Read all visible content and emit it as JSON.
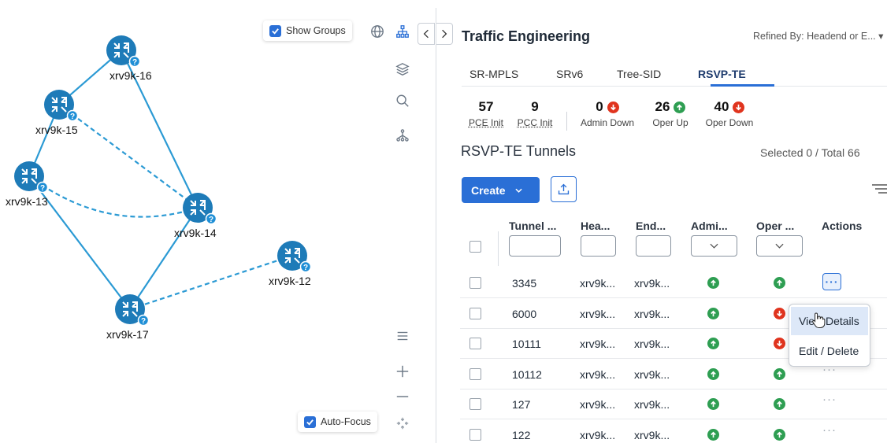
{
  "topology": {
    "show_groups_label": "Show Groups",
    "auto_focus_label": "Auto-Focus",
    "nodes": [
      {
        "id": "xrv9k-16",
        "label": "xrv9k-16"
      },
      {
        "id": "xrv9k-15",
        "label": "xrv9k-15"
      },
      {
        "id": "xrv9k-13",
        "label": "xrv9k-13"
      },
      {
        "id": "xrv9k-14",
        "label": "xrv9k-14"
      },
      {
        "id": "xrv9k-12",
        "label": "xrv9k-12"
      },
      {
        "id": "xrv9k-17",
        "label": "xrv9k-17"
      }
    ],
    "node_color": "#1e7bb8",
    "link_color": "#2b9ad4",
    "badge_text": "?",
    "tools": [
      "globe-icon",
      "hierarchy-icon",
      "layers-icon",
      "search-icon",
      "tree-icon",
      "list-icon",
      "zoom-in-icon",
      "zoom-out-icon",
      "fit-icon"
    ],
    "zoom_in": "+",
    "zoom_out": "—"
  },
  "panel": {
    "title": "Traffic Engineering",
    "refined_by": "Refined By: Headend or E... ▾",
    "tabs": [
      {
        "label": "SR-MPLS",
        "active": false
      },
      {
        "label": "SRv6",
        "active": false
      },
      {
        "label": "Tree-SID",
        "active": false
      },
      {
        "label": "RSVP-TE",
        "active": true
      }
    ],
    "stats": [
      {
        "value": "57",
        "label": "PCE Init",
        "status": "none"
      },
      {
        "value": "9",
        "label": "PCC Init",
        "status": "none"
      },
      {
        "value": "0",
        "label": "Admin Down",
        "status": "down"
      },
      {
        "value": "26",
        "label": "Oper Up",
        "status": "up"
      },
      {
        "value": "40",
        "label": "Oper Down",
        "status": "down"
      }
    ],
    "section_title": "RSVP-TE Tunnels",
    "selected_total": "Selected 0 / Total 66",
    "create_label": "Create",
    "columns": [
      "Tunnel ...",
      "Hea...",
      "End...",
      "Admi...",
      "Oper ...",
      "Actions"
    ],
    "rows": [
      {
        "tunnel": "3345",
        "headend": "xrv9k...",
        "endpoint": "xrv9k...",
        "admin": "up",
        "oper": "up",
        "actions": "···"
      },
      {
        "tunnel": "6000",
        "headend": "xrv9k...",
        "endpoint": "xrv9k...",
        "admin": "up",
        "oper": "down",
        "actions": ""
      },
      {
        "tunnel": "10111",
        "headend": "xrv9k...",
        "endpoint": "xrv9k...",
        "admin": "up",
        "oper": "down",
        "actions": ""
      },
      {
        "tunnel": "10112",
        "headend": "xrv9k...",
        "endpoint": "xrv9k...",
        "admin": "up",
        "oper": "up",
        "actions": "···"
      },
      {
        "tunnel": "127",
        "headend": "xrv9k...",
        "endpoint": "xrv9k...",
        "admin": "up",
        "oper": "up",
        "actions": "···"
      },
      {
        "tunnel": "122",
        "headend": "xrv9k...",
        "endpoint": "xrv9k...",
        "admin": "up",
        "oper": "up",
        "actions": "···"
      }
    ],
    "context_menu": [
      "View Details",
      "Edit / Delete"
    ],
    "colors": {
      "accent": "#2a6fd6",
      "up": "#2e9e52",
      "down": "#e0341e"
    }
  }
}
